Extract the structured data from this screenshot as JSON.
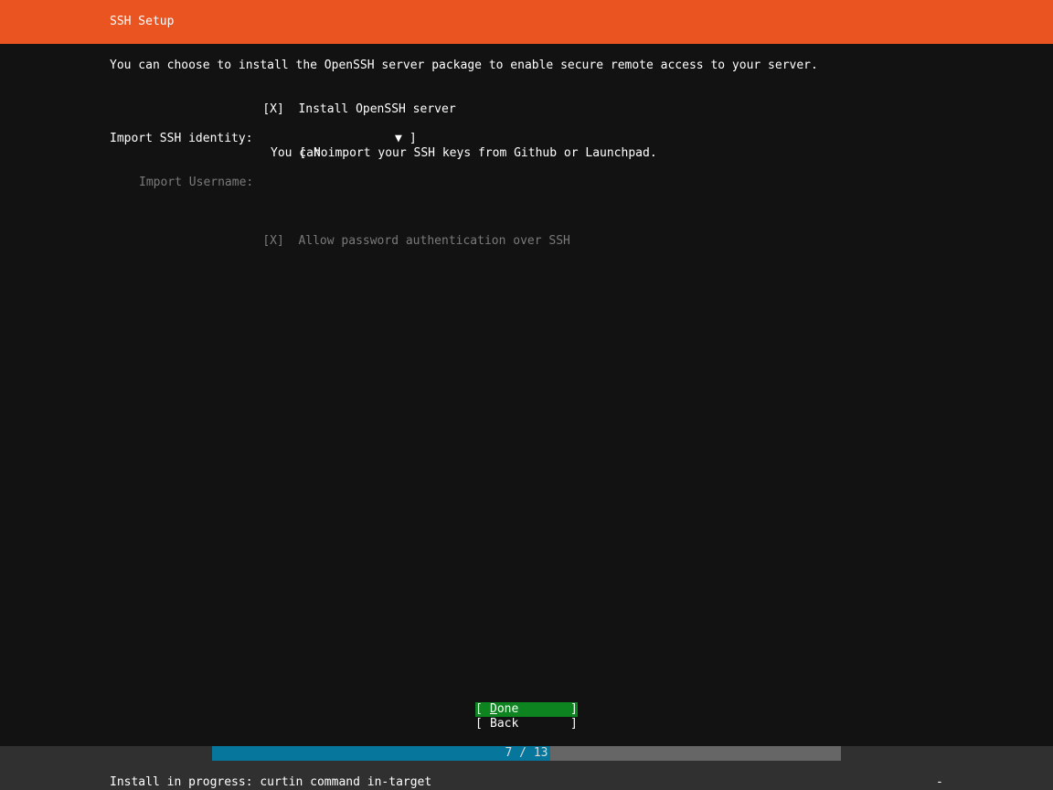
{
  "header": {
    "title": "SSH Setup",
    "color": "#e95420"
  },
  "main": {
    "intro": "You can choose to install the OpenSSH server package to enable secure remote access to your server.",
    "install_openssh": {
      "checkbox": "[X]",
      "label": "Install OpenSSH server"
    },
    "import_identity": {
      "label": "Import SSH identity:",
      "select_open": "[ ",
      "selected_value": "No",
      "arrow": "▼",
      "select_close": " ]",
      "help": "You can import your SSH keys from Github or Launchpad."
    },
    "import_username": {
      "label": "Import Username:",
      "value": ""
    },
    "allow_password": {
      "checkbox": "[X]",
      "label": "Allow password authentication over SSH"
    }
  },
  "buttons": {
    "done": {
      "open": "[ ",
      "hotkey": "D",
      "rest": "one",
      "close": "]"
    },
    "back": {
      "open": "[ ",
      "label": "Back",
      "close": "]"
    },
    "done_color": "#0e8420"
  },
  "footer": {
    "progress_text": "7 / 13",
    "progress_current": 7,
    "progress_total": 13,
    "progress_color": "#06769c",
    "status": "Install in progress: curtin command in-target",
    "spinner": "-"
  }
}
